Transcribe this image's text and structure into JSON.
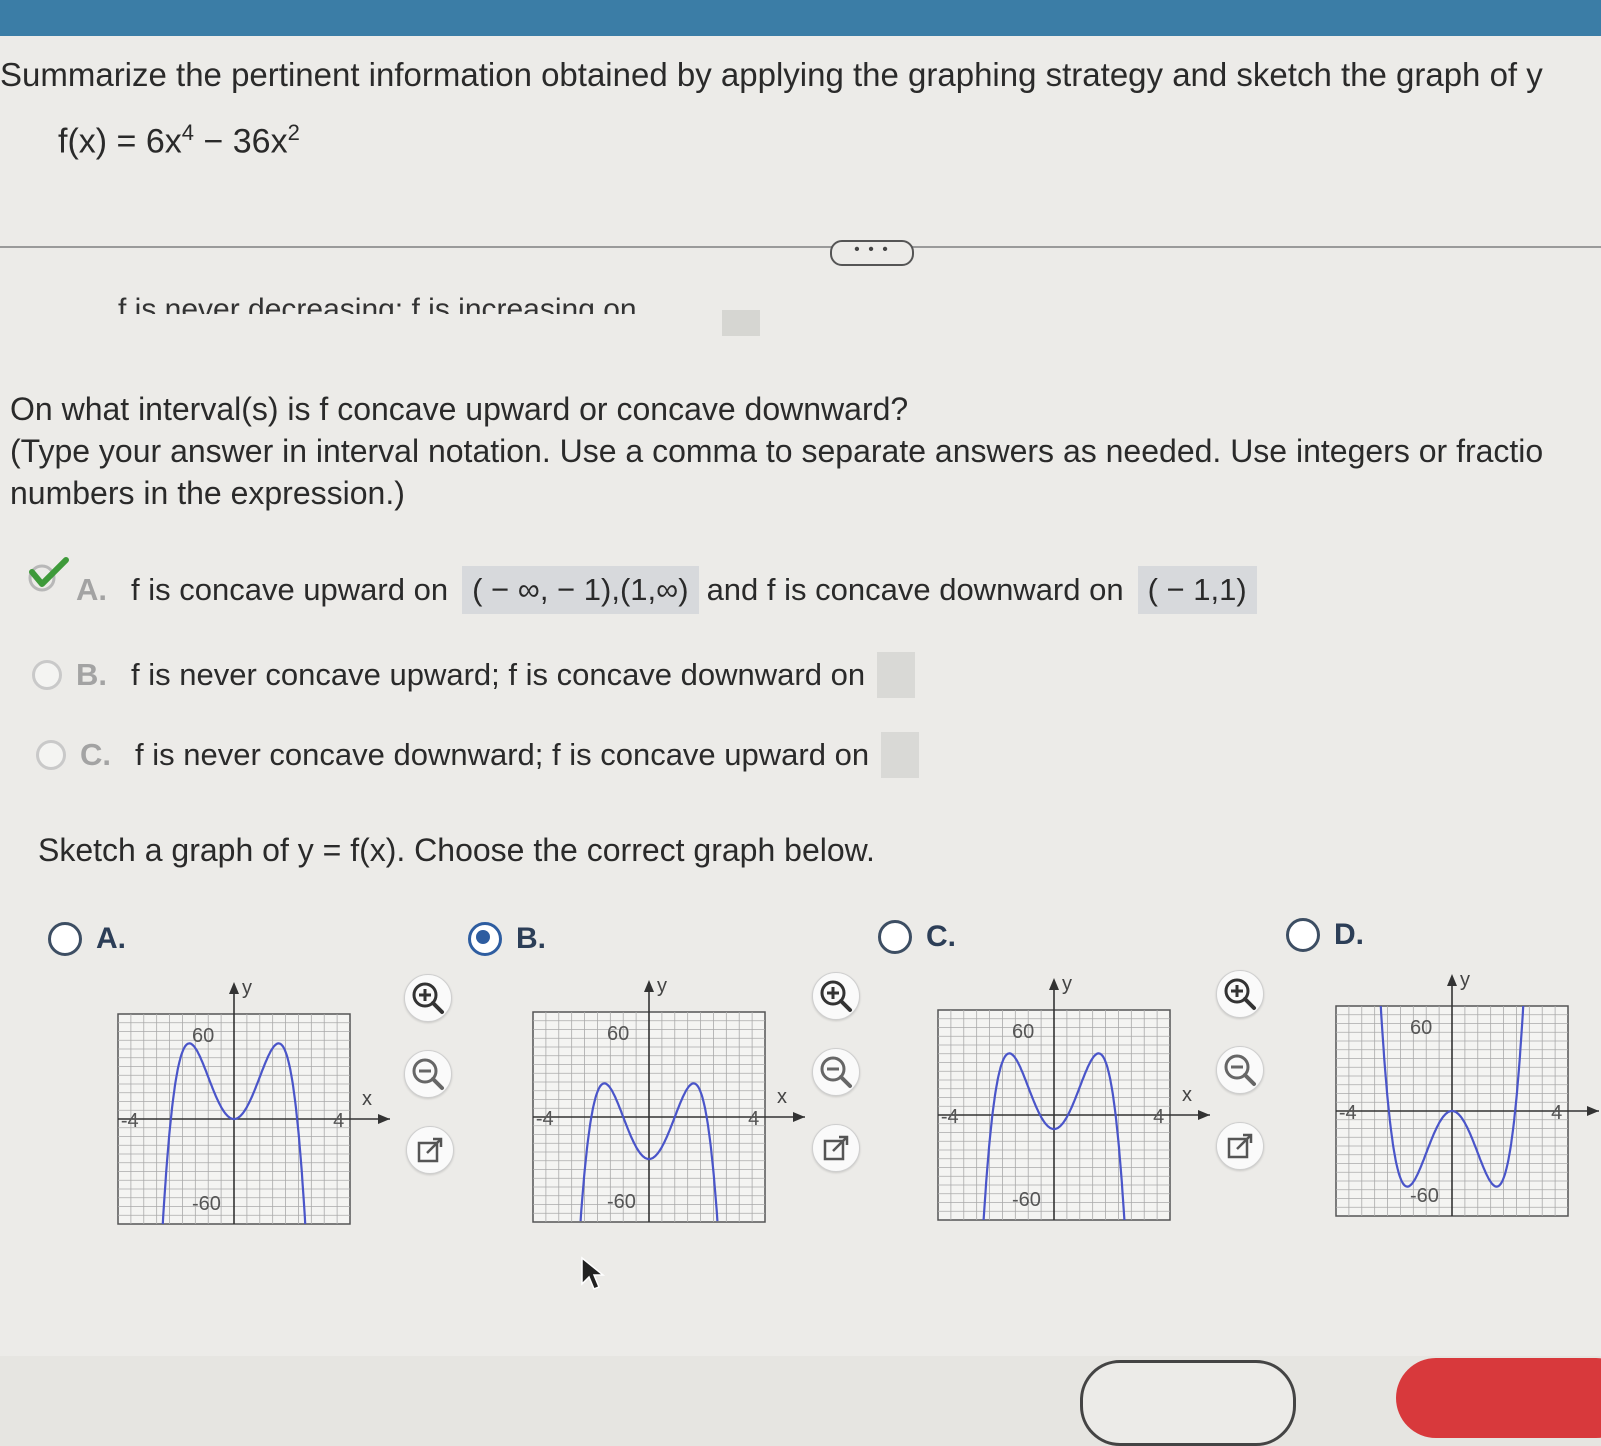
{
  "prompt": "Summarize the pertinent information obtained by applying the graphing strategy and sketch the graph of y",
  "function": {
    "lhs": "f(x) = 6x",
    "exp1": "4",
    "mid": " − 36x",
    "exp2": "2"
  },
  "more_button": "• • •",
  "cutoff_text": "f is never decreasing; f is increasing on",
  "question": {
    "line1": "On what interval(s) is f concave upward or concave downward?",
    "line2": "(Type your answer in interval notation. Use a comma to separate answers as needed. Use integers or fractio",
    "line3": "numbers in the expression.)"
  },
  "concavity_options": [
    {
      "letter": "A.",
      "text1": "f is concave upward on",
      "answer1": "( − ∞, − 1),(1,∞)",
      "text2": "and f is concave downward on",
      "answer2": "( − 1,1)",
      "selected": true
    },
    {
      "letter": "B.",
      "text": "f is never concave upward; f is concave downward on",
      "selected": false
    },
    {
      "letter": "C.",
      "text": "f is never concave downward; f is concave upward on",
      "selected": false
    }
  ],
  "sketch_prompt": "Sketch a graph of y = f(x). Choose the correct graph below.",
  "graph_choices": [
    {
      "letter": "A.",
      "selected": false
    },
    {
      "letter": "B.",
      "selected": true
    },
    {
      "letter": "C.",
      "selected": false
    },
    {
      "letter": "D.",
      "selected": false
    }
  ],
  "graph_labels": {
    "y": "y",
    "x": "x",
    "ymax": "60",
    "ymin": "-60",
    "xmin": "-4",
    "xmax": "4"
  },
  "icons": [
    "zoom-in-icon",
    "zoom-out-icon",
    "popout-icon",
    "check-icon",
    "cursor-icon"
  ],
  "colors": {
    "curve": "#4a55c9",
    "accent": "#2e5da0",
    "check": "#3e9a3a",
    "topbar": "#3b7da6"
  }
}
